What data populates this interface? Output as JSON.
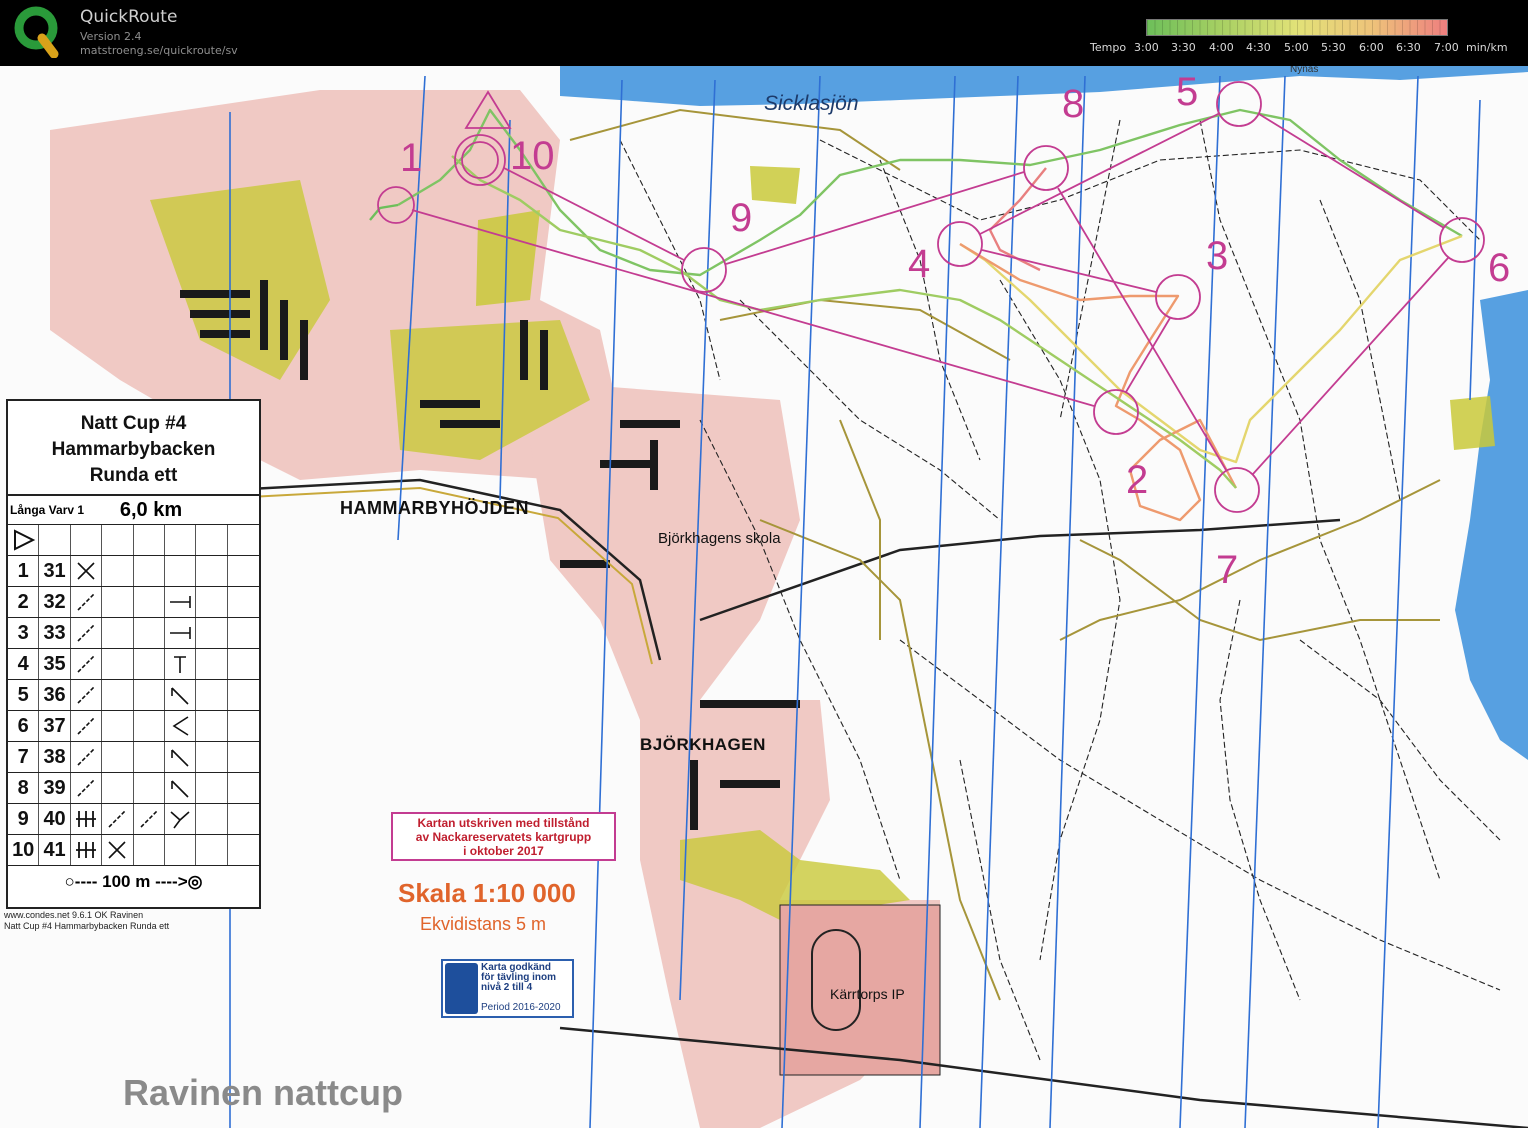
{
  "header": {
    "app_name": "QuickRoute",
    "version": "Version 2.4",
    "url": "matstroeng.se/quickroute/sv",
    "logo_letter": "Q",
    "logo_colors": [
      "#2a9a3a",
      "#d9a21a"
    ],
    "tempo_label": "Tempo",
    "tempo_ticks": [
      "3:00",
      "3:30",
      "4:00",
      "4:30",
      "5:00",
      "5:30",
      "6:00",
      "6:30",
      "7:00"
    ],
    "tempo_unit": "min/km",
    "tempo_colors": [
      "#6dbf5a",
      "#a8d063",
      "#e2e278",
      "#eec37a",
      "#ee7f7f"
    ]
  },
  "map": {
    "lake_name": "Sicklasjön",
    "road_label": "Nynäs",
    "places": {
      "hammarbyhojden": "HAMMARBYHÖJDEN",
      "bjorkhagens_skola": "Björkhagens skola",
      "bjorkhagen": "BJÖRKHAGEN",
      "karrtorps_ip": "Kärrtorps IP"
    },
    "control_numbers": [
      "1",
      "2",
      "3",
      "4",
      "5",
      "6",
      "7",
      "8",
      "9",
      "10"
    ],
    "colors": {
      "course": "#c33c91",
      "magnetic_north": "#2f6fd4",
      "water": "#3a8fdc",
      "open_land": "#c9c93a",
      "buildings_area": "#e2a4a0"
    }
  },
  "description_sheet": {
    "title_lines": [
      "Natt Cup #4",
      "Hammarbybacken",
      "Runda ett"
    ],
    "course_class": "Långa Varv 1",
    "course_length": "6,0 km",
    "start_symbol": "start-triangle",
    "rows": [
      {
        "num": "1",
        "code": "31",
        "symbols": [
          "crossing",
          "",
          "",
          "",
          ""
        ]
      },
      {
        "num": "2",
        "code": "32",
        "symbols": [
          "path",
          "",
          "",
          "path-junction",
          ""
        ]
      },
      {
        "num": "3",
        "code": "33",
        "symbols": [
          "path",
          "",
          "",
          "path-junction",
          ""
        ]
      },
      {
        "num": "4",
        "code": "35",
        "symbols": [
          "path",
          "",
          "",
          "path-end",
          ""
        ]
      },
      {
        "num": "5",
        "code": "36",
        "symbols": [
          "path",
          "",
          "",
          "path-bend",
          ""
        ]
      },
      {
        "num": "6",
        "code": "37",
        "symbols": [
          "path",
          "",
          "",
          "path-angle",
          ""
        ]
      },
      {
        "num": "7",
        "code": "38",
        "symbols": [
          "path",
          "",
          "",
          "path-bend",
          ""
        ]
      },
      {
        "num": "8",
        "code": "39",
        "symbols": [
          "path",
          "",
          "",
          "path-bend",
          ""
        ]
      },
      {
        "num": "9",
        "code": "40",
        "symbols": [
          "marsh-bars",
          "path",
          "path",
          "fork",
          ""
        ]
      },
      {
        "num": "10",
        "code": "41",
        "symbols": [
          "marsh-bars",
          "crossing",
          "",
          "",
          ""
        ]
      }
    ],
    "finish_text": "○---- 100 m ---->◎",
    "source_line1": "www.condes.net 9.6.1 OK Ravinen",
    "source_line2": "Natt Cup #4 Hammarbybacken Runda ett"
  },
  "notes": {
    "permission": [
      "Kartan utskriven med tillstånd",
      "av Nackareservatets kartgrupp",
      "i oktober 2017"
    ],
    "scale": "Skala 1:10 000",
    "contour": "Ekvidistans 5 m",
    "badge_text": [
      "Karta godkänd",
      "för tävling inom",
      "nivå 2 till 4"
    ],
    "badge_period": "Period 2016-2020",
    "club": "Ravinen nattcup"
  }
}
